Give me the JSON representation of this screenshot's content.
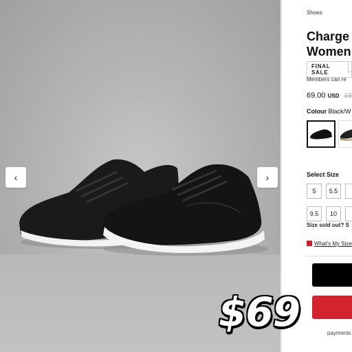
{
  "gallery": {
    "prev_icon": "chevron-left-icon",
    "next_icon": "chevron-right-icon",
    "prev_glyph": "‹",
    "next_glyph": "›"
  },
  "product": {
    "breadcrumb": "Shoes",
    "title_line1": "Charge",
    "title_line2": "Women",
    "badge": "FINAL SALE",
    "members_text": "Members can re",
    "price": "69.00",
    "currency": "USD",
    "original_price": "13",
    "colour_label": "Colour",
    "colour_value": "Black/W"
  },
  "sizes": {
    "label": "Select Size",
    "row1": [
      "5",
      "5.5"
    ],
    "row2": [
      "9.5",
      "10"
    ],
    "sold_out": "Size sold out? S",
    "whats_my_size": "What's My Size"
  },
  "checkout": {
    "payments_text": "payments o"
  },
  "overlay": {
    "sticker_text": "$69"
  },
  "colors": {
    "accent_red": "#d2232e",
    "black": "#000000"
  }
}
